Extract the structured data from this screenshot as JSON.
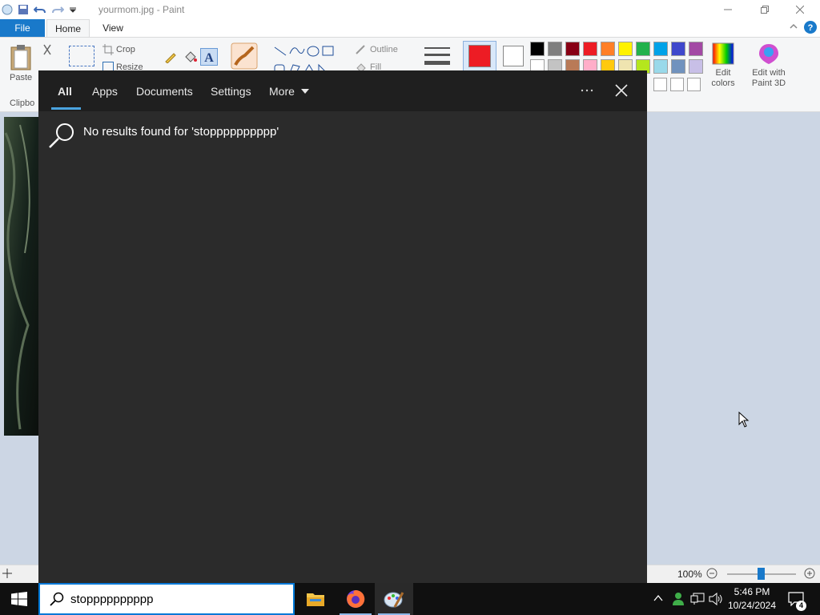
{
  "window": {
    "title": "yourmom.jpg - Paint"
  },
  "ribbon": {
    "tabs": [
      "File",
      "Home",
      "View"
    ],
    "clipboard": {
      "paste_label": "Paste",
      "group_label": "Clipbo"
    },
    "image": {
      "crop_label": "Crop",
      "resize_label": "Resize"
    },
    "shapes": {
      "outline_label": "Outline",
      "fill_label": "Fill"
    },
    "edit_colors_label": "Edit colors",
    "paint3d_label": "Edit with Paint 3D",
    "color1": "#ed1c24",
    "color2": "#ffffff",
    "palette_row1": [
      "#000000",
      "#7f7f7f",
      "#880015",
      "#ed1c24",
      "#ff7f27",
      "#fff200",
      "#22b14c",
      "#00a2e8",
      "#3f48cc",
      "#a349a4"
    ],
    "palette_row2": [
      "#ffffff",
      "#c3c3c3",
      "#b97a57",
      "#ffaec9",
      "#ffc90e",
      "#efe4b0",
      "#b5e61d",
      "#99d9ea",
      "#7092be",
      "#c8bfe7"
    ]
  },
  "statusbar": {
    "zoom": "100%"
  },
  "search": {
    "tabs": [
      "All",
      "Apps",
      "Documents",
      "Settings",
      "More"
    ],
    "no_results": "No results found for 'stopppppppppp'",
    "query": "stopppppppppp"
  },
  "taskbar": {
    "time": "5:46 PM",
    "date": "10/24/2024",
    "notification_count": "4"
  },
  "icons": [
    "windows-start-icon",
    "search-icon",
    "file-explorer-icon",
    "firefox-icon",
    "paint-icon",
    "chevron-up-icon",
    "network-icon",
    "volume-icon",
    "notification-icon"
  ]
}
